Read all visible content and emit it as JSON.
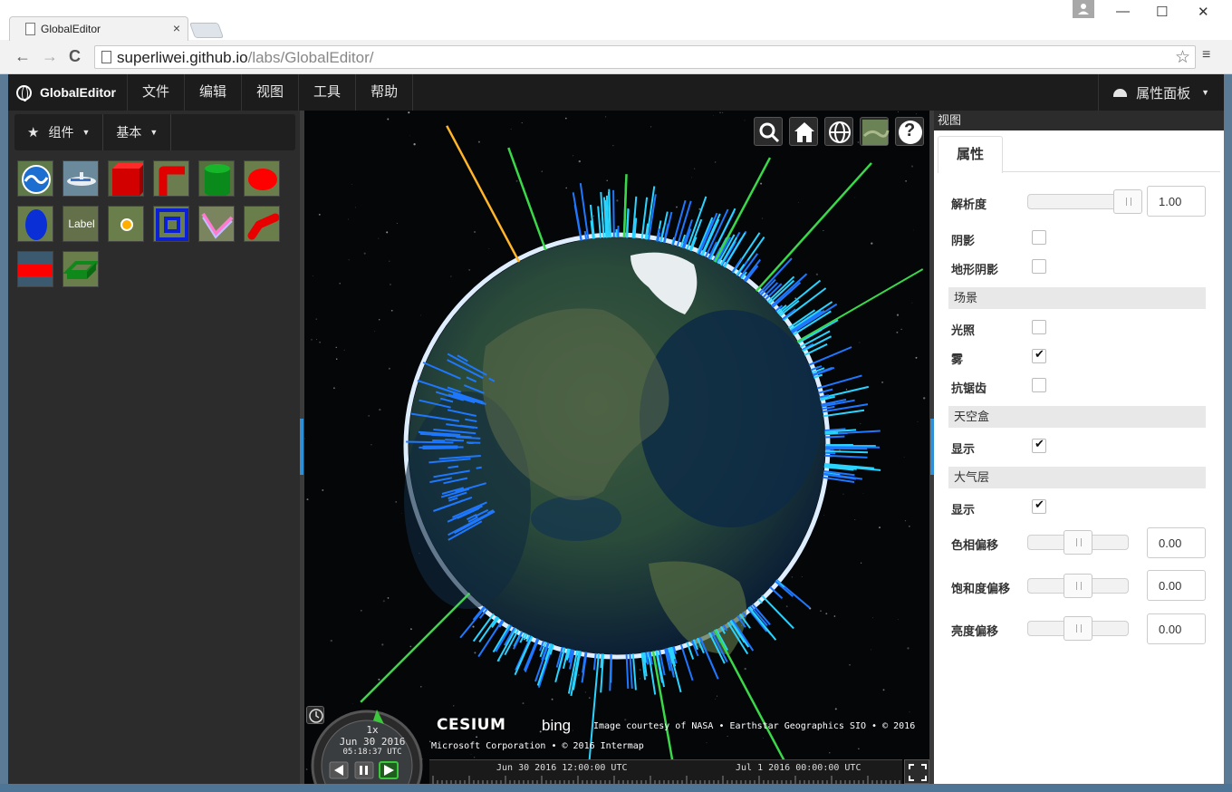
{
  "browser": {
    "tab_title": "GlobalEditor",
    "tab_close": "×",
    "url_host": "superliwei.github.io",
    "url_path": "/labs/GlobalEditor/",
    "back": "←",
    "forward": "→",
    "reload": "C",
    "star": "☆",
    "menu": "≡",
    "minimize": "—",
    "maximize": "☐",
    "close": "✕"
  },
  "appbar": {
    "brand": "GlobalEditor",
    "menus": [
      "文件",
      "编辑",
      "视图",
      "工具",
      "帮助"
    ],
    "panel_toggle": "属性面板",
    "caret": "▼"
  },
  "leftpanel": {
    "group_label": "组件",
    "category_label": "基本",
    "star_icon": "★",
    "caret": "▼",
    "tiles": [
      {
        "name": "terrain-tile"
      },
      {
        "name": "model-tile"
      },
      {
        "name": "box-tile"
      },
      {
        "name": "corridor-tile"
      },
      {
        "name": "cylinder-tile"
      },
      {
        "name": "ellipse-tile"
      },
      {
        "name": "ellipsoid-tile"
      },
      {
        "name": "label-tile",
        "text": "Label"
      },
      {
        "name": "point-tile"
      },
      {
        "name": "polygon-tile"
      },
      {
        "name": "polyline-tile"
      },
      {
        "name": "polyline-volume-tile"
      },
      {
        "name": "rectangle-tile"
      },
      {
        "name": "wall-tile"
      }
    ]
  },
  "viewer": {
    "help": "?",
    "cesium_logo": "CESIUM",
    "bing_logo": "bing",
    "credit_line1": "Image courtesy of NASA • Earthstar Geographics SIO • © 2016",
    "credit_line2": "Microsoft Corporation • © 2016 Intermap",
    "timeline_label1": "Jun 30 2016 12:00:00 UTC",
    "timeline_label2": "Jul 1 2016 00:00:00 UTC",
    "speed": "1x",
    "date": "Jun 30 2016",
    "time": "05:18:37 UTC",
    "colors": {
      "globe_ocean": "#0d2a45",
      "bar_cyan": "#2ad4ff",
      "bar_blue": "#1e78ff",
      "bar_green": "#3bd84a",
      "bar_yellow": "#ffb62a"
    }
  },
  "rightpanel": {
    "header": "视图",
    "tab": "属性",
    "resolution_label": "解析度",
    "resolution_value": "1.00",
    "resolution_level": 1.0,
    "shadows_label": "阴影",
    "shadows": false,
    "terrain_shadows_label": "地形阴影",
    "terrain_shadows": false,
    "scene_section": "场景",
    "lighting_label": "光照",
    "lighting": false,
    "fog_label": "雾",
    "fog": true,
    "aa_label": "抗锯齿",
    "aa": false,
    "skybox_section": "天空盒",
    "skybox_show_label": "显示",
    "skybox_show": true,
    "atmosphere_section": "大气层",
    "atmosphere_show_label": "显示",
    "atmosphere_show": true,
    "hue_label": "色相偏移",
    "hue_value": "0.00",
    "saturation_label": "饱和度偏移",
    "saturation_value": "0.00",
    "brightness_label": "亮度偏移",
    "brightness_value": "0.00"
  }
}
